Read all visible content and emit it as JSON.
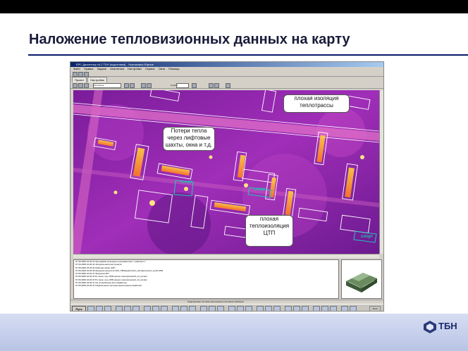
{
  "slide": {
    "title": "Наложение тепловизионных данных на карту"
  },
  "logo": {
    "name": "ТБН",
    "icon": "tbn-logo-icon"
  },
  "app": {
    "window_title": "ЕРС Диспетчер v4.2 ТБН [подготовка] - Чертановка Южное",
    "menu": [
      "Файл",
      "Правка",
      "Задачи",
      "Аналитика",
      "Настройки",
      "Сервис",
      "Окна",
      "Помощь"
    ],
    "tabs": [
      "Проект",
      "Настройки"
    ],
    "layer_select": "Теплосеть",
    "scale_label": "Слой:",
    "scale_value": "1"
  },
  "map": {
    "colors": {
      "base": "#9a2ab8",
      "hot": "#ffb020",
      "outline": "#ffffff"
    },
    "labels": {
      "sport1": "спорт",
      "sport2": "спорт",
      "sport3": "спорт"
    },
    "callouts": {
      "insulation": "плохая изоляция теплотрассы",
      "heat_loss": "Потери тепла через лифтовые шахты, окна и т.д.",
      "ctp": "плохая теплоизоляция ЦТП"
    }
  },
  "log": {
    "lines": [
      "07.06.2006 16:20:41   Программа запущена пользователем <<yakovlev>>",
      "07.06.2006 16:20:41   Загрузка настроек проекта",
      "07.06.2006 16:20:41   Рабочая папка: ЕРС",
      "07.06.2006 16:20:46   Загрузка проекта D:\\GIS_TBN\\teploviz\\sim_chertanovo\\sim_south.ZPR",
      "07.06.2006 16:20:47   Загрузка ЦТП",
      "07.06.2006 16:20:47   В слоев: путь ZPR-проект-электрической_ctl_ccenter",
      "07.06.2006 16:20:47   В слоев: путь ZPR-проект-электрической_ctl_ccenter",
      "07.06.2006 16:20:47   Не установлены все параметры",
      "07.06.2006 16:20:47   Подключение системы мониторинга обработки"
    ]
  },
  "statusbar": {
    "text": "Подключение системы мониторинга состояния приборов"
  },
  "taskbar": {
    "start": "Пуск",
    "clock": "16:21"
  }
}
